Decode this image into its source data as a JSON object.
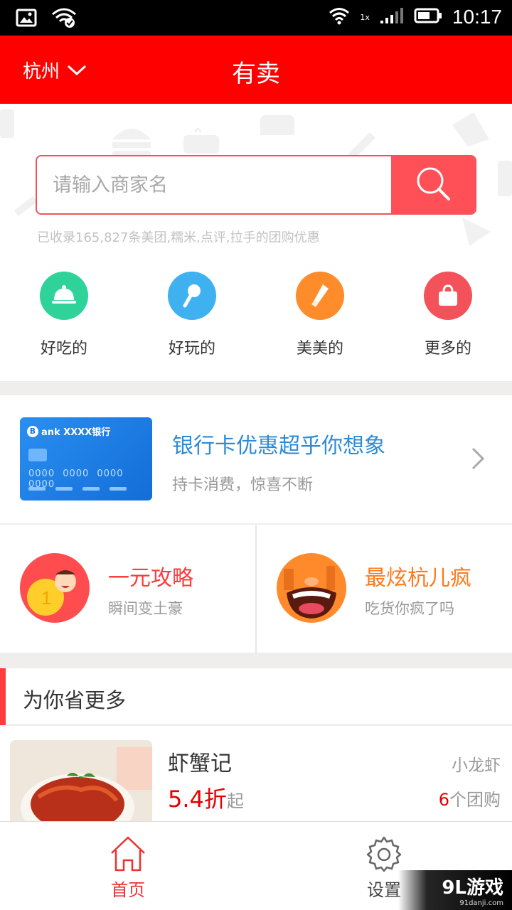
{
  "status_bar": {
    "time": "10:17",
    "network": "1x"
  },
  "header": {
    "city": "杭州",
    "title": "有卖"
  },
  "search": {
    "placeholder": "请输入商家名",
    "collected_note": "已收录165,827条美团,糯米,点评,拉手的团购优惠"
  },
  "categories": [
    {
      "label": "好吃的",
      "icon": "food-cloche-icon",
      "color": "#2fd39a"
    },
    {
      "label": "好玩的",
      "icon": "microphone-icon",
      "color": "#3fb1f0"
    },
    {
      "label": "美美的",
      "icon": "lipstick-icon",
      "color": "#ff8c2a"
    },
    {
      "label": "更多的",
      "icon": "shopping-bag-icon",
      "color": "#f4525a"
    }
  ],
  "bank_banner": {
    "card_bank": "ank XXXX银行",
    "card_number": "0000 0000 0000 0000",
    "title": "银行卡优惠超乎你想象",
    "subtitle": "持卡消费，惊喜不断"
  },
  "promos": [
    {
      "title": "一元攻略",
      "subtitle": "瞬间变土豪",
      "title_color": "#ff3b3b"
    },
    {
      "title": "最炫杭儿疯",
      "subtitle": "吃货你疯了吗",
      "title_color": "#ff7a1a"
    }
  ],
  "section": {
    "title": "为你省更多"
  },
  "deal": {
    "name": "虾蟹记",
    "tag": "小龙虾",
    "discount": "5.4折",
    "discount_suffix": "起",
    "deal_count": "6",
    "deal_count_suffix": "个团购"
  },
  "tabs": [
    {
      "label": "首页",
      "active": true
    },
    {
      "label": "设置",
      "active": false
    }
  ],
  "watermark": {
    "text": "9L游戏",
    "sub": "91danji.com"
  },
  "colors": {
    "brand_red": "#fe0000",
    "accent_red": "#ff5057",
    "link_blue": "#2d8bd6"
  }
}
